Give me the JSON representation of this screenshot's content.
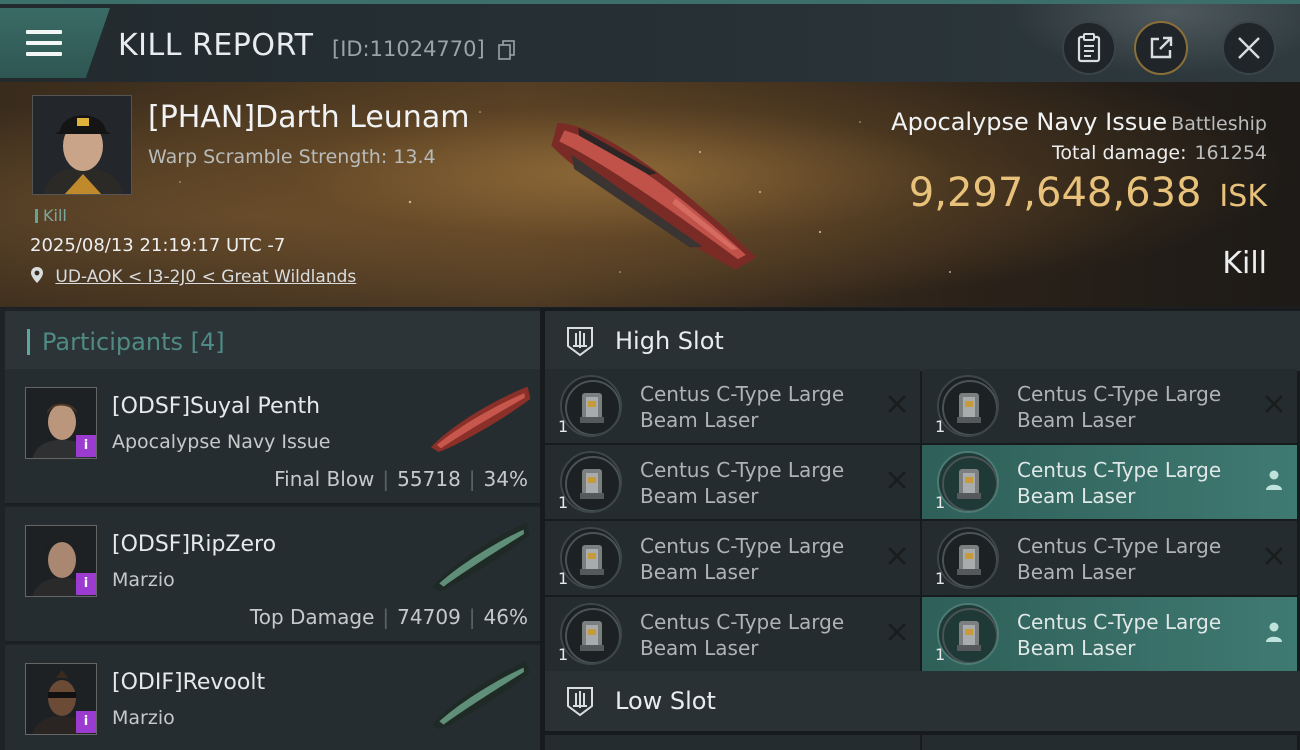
{
  "topbar": {
    "title": "KILL REPORT",
    "id_label": "[ID:11024770]"
  },
  "victim": {
    "name": "[PHAN]Darth Leunam",
    "warp_scramble": "Warp Scramble Strength: 13.4",
    "tag": "Kill",
    "timestamp": "2025/08/13 21:19:17 UTC -7",
    "location": "UD-AOK < I3-2J0 < Great Wildlands",
    "ship_name": "Apocalypse Navy Issue",
    "ship_class": "Battleship",
    "total_damage_label": "Total damage:",
    "total_damage": "161254",
    "isk_value": "9,297,648,638",
    "isk_unit": "ISK",
    "result": "Kill"
  },
  "participants": {
    "header": "Participants [4]",
    "rows": [
      {
        "name": "[ODSF]Suyal Penth",
        "ship": "Apocalypse Navy Issue",
        "role": "Final Blow",
        "damage": "55718",
        "percent": "34%",
        "badge": "i"
      },
      {
        "name": "[ODSF]RipZero",
        "ship": "Marzio",
        "role": "Top Damage",
        "damage": "74709",
        "percent": "46%",
        "badge": "i"
      },
      {
        "name": "[ODIF]Revoolt",
        "ship": "Marzio",
        "role": "",
        "damage": "",
        "percent": "",
        "badge": "i"
      }
    ]
  },
  "fitting": {
    "high_slot_title": "High Slot",
    "low_slot_title": "Low Slot",
    "high_modules": [
      {
        "name": "Centus C-Type Large Beam Laser",
        "qty": "1",
        "status": "destroyed"
      },
      {
        "name": "Centus C-Type Large Beam Laser",
        "qty": "1",
        "status": "destroyed"
      },
      {
        "name": "Centus C-Type Large Beam Laser",
        "qty": "1",
        "status": "destroyed"
      },
      {
        "name": "Centus C-Type Large Beam Laser",
        "qty": "1",
        "status": "dropped"
      },
      {
        "name": "Centus C-Type Large Beam Laser",
        "qty": "1",
        "status": "destroyed"
      },
      {
        "name": "Centus C-Type Large Beam Laser",
        "qty": "1",
        "status": "destroyed"
      },
      {
        "name": "Centus C-Type Large Beam Laser",
        "qty": "1",
        "status": "destroyed"
      },
      {
        "name": "Centus C-Type Large Beam Laser",
        "qty": "1",
        "status": "dropped"
      }
    ]
  },
  "colors": {
    "accent_teal": "#3f7a72",
    "isk_gold": "#e8c27a",
    "badge_purple": "#9b3bd0"
  }
}
